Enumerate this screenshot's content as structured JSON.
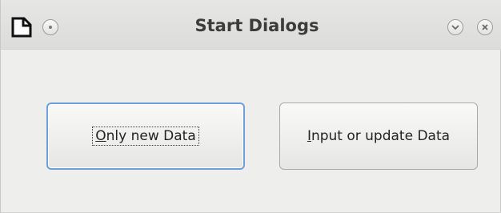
{
  "window": {
    "title": "Start Dialogs"
  },
  "titlebar": {
    "app_icon": "document-icon",
    "menu_icon": "window-menu-icon",
    "minimize_icon": "chevron-down-icon",
    "close_icon": "close-icon"
  },
  "buttons": {
    "only_new_data": {
      "mnemonic": "O",
      "rest": "nly new Data",
      "focused": true
    },
    "input_or_update_data": {
      "mnemonic": "I",
      "rest": "nput or update Data",
      "focused": false
    }
  },
  "colors": {
    "window_bg": "#eeeeec",
    "focus_border": "#6f9fd8",
    "title_text": "#3c3c3c"
  }
}
